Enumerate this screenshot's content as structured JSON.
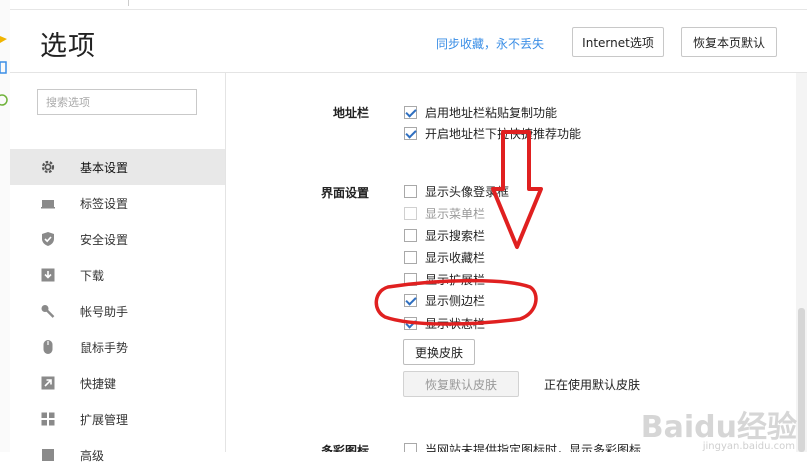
{
  "header": {
    "title": "选项",
    "sync_link": "同步收藏，永不丢失",
    "internet_button": "Internet选项",
    "restore_button": "恢复本页默认"
  },
  "sidebar": {
    "search_placeholder": "搜索选项",
    "items": [
      {
        "label": "基本设置",
        "icon": "gear-icon",
        "active": true
      },
      {
        "label": "标签设置",
        "icon": "tab-icon",
        "active": false
      },
      {
        "label": "安全设置",
        "icon": "shield-icon",
        "active": false
      },
      {
        "label": "下载",
        "icon": "download-icon",
        "active": false
      },
      {
        "label": "帐号助手",
        "icon": "key-icon",
        "active": false
      },
      {
        "label": "鼠标手势",
        "icon": "mouse-icon",
        "active": false
      },
      {
        "label": "快捷键",
        "icon": "shortcut-arrow-icon",
        "active": false
      },
      {
        "label": "扩展管理",
        "icon": "extensions-grid-icon",
        "active": false
      },
      {
        "label": "高级",
        "icon": "advanced-icon",
        "active": false
      }
    ]
  },
  "content": {
    "address_bar": {
      "title": "地址栏",
      "options": [
        {
          "label": "启用地址栏粘贴复制功能",
          "checked": true
        },
        {
          "label": "开启地址栏下拉快捷推荐功能",
          "checked": true
        }
      ]
    },
    "interface": {
      "title": "界面设置",
      "options": [
        {
          "label": "显示头像登录框",
          "checked": false,
          "disabled": false
        },
        {
          "label": "显示菜单栏",
          "checked": false,
          "disabled": true
        },
        {
          "label": "显示搜索栏",
          "checked": false,
          "disabled": false
        },
        {
          "label": "显示收藏栏",
          "checked": false,
          "disabled": false
        },
        {
          "label": "显示扩展栏",
          "checked": false,
          "disabled": false
        },
        {
          "label": "显示侧边栏",
          "checked": true,
          "disabled": false
        },
        {
          "label": "显示状态栏",
          "checked": true,
          "disabled": false
        }
      ],
      "change_skin_button": "更换皮肤",
      "default_skin_button": "恢复默认皮肤",
      "skin_status": "正在使用默认皮肤"
    },
    "favicon": {
      "title": "多彩图标",
      "options": [
        {
          "label": "当网站未提供指定图标时，显示多彩图标",
          "checked": false
        }
      ]
    }
  },
  "watermark": {
    "logo": "Baidu经验",
    "url": "jingyan.baidu.com"
  },
  "colors": {
    "accent": "#3a8ee6",
    "check": "#2f6fc0",
    "annotation": "#e02020",
    "active_nav": "#e8e8e8"
  }
}
